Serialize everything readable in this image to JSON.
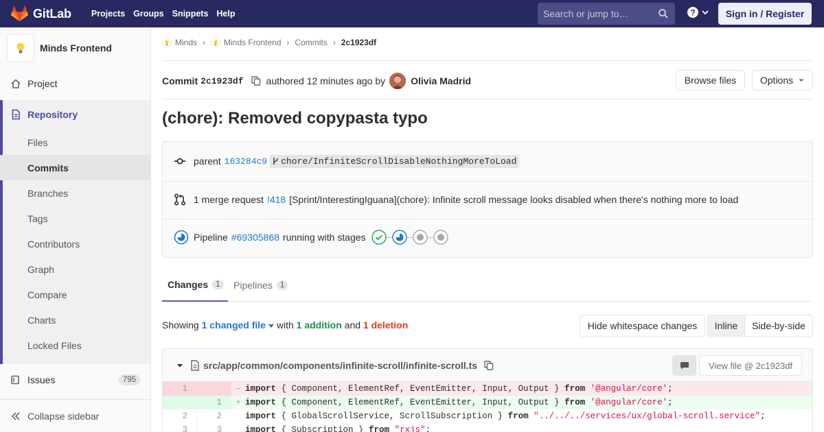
{
  "navbar": {
    "brand": "GitLab",
    "links": [
      "Projects",
      "Groups",
      "Snippets",
      "Help"
    ],
    "search_placeholder": "Search or jump to…",
    "sign_in": "Sign in / Register"
  },
  "sidebar": {
    "project_name": "Minds Frontend",
    "project": "Project",
    "repository": "Repository",
    "sub_items": [
      "Files",
      "Commits",
      "Branches",
      "Tags",
      "Contributors",
      "Graph",
      "Compare",
      "Charts",
      "Locked Files"
    ],
    "active_sub": "Commits",
    "issues": "Issues",
    "issues_count": "795",
    "collapse": "Collapse sidebar"
  },
  "breadcrumb": [
    "Minds",
    "Minds Frontend",
    "Commits",
    "2c1923df"
  ],
  "commit": {
    "label": "Commit",
    "sha": "2c1923df",
    "authored": "authored 12 minutes ago by",
    "author": "Olivia Madrid",
    "browse_files": "Browse files",
    "options": "Options",
    "title": "(chore): Removed copypasta typo"
  },
  "info": {
    "parent_label": "parent",
    "parent_sha": "163284c9",
    "branch": "chore/InfiniteScrollDisableNothingMoreToLoad",
    "mr_prefix": "1 merge request",
    "mr_id": "!418",
    "mr_title": "[Sprint/InterestingIguana](chore): Infinite scroll message looks disabled when there's nothing more to load",
    "pipeline_label": "Pipeline",
    "pipeline_id": "#69305868",
    "pipeline_status": "running with stages"
  },
  "tabs": [
    {
      "label": "Changes",
      "count": "1"
    },
    {
      "label": "Pipelines",
      "count": "1"
    }
  ],
  "summary": {
    "showing": "Showing",
    "changed": "1 changed file",
    "with": "with",
    "additions": "1 addition",
    "and": "and",
    "deletions": "1 deletion",
    "hide_ws": "Hide whitespace changes",
    "inline": "Inline",
    "side_by_side": "Side-by-side"
  },
  "file": {
    "path": "src/app/common/components/infinite-scroll/infinite-scroll.ts",
    "view_file": "View file @ 2c1923df"
  },
  "diff_lines": [
    {
      "type": "del",
      "old": "1",
      "new": "",
      "sign": "-",
      "kw": "import",
      "mid": " { Component, ElementRef, EventEmitter, Input, Output } ",
      "kw2": "from",
      "str": " '@angular/core'",
      "end": ";"
    },
    {
      "type": "add",
      "old": "",
      "new": "1",
      "sign": "+",
      "kw": "import",
      "mid": " { Component, ElementRef, EventEmitter, Input, Output } ",
      "kw2": "from",
      "str": " '@angular/core'",
      "end": ";"
    },
    {
      "type": "ctx",
      "old": "2",
      "new": "2",
      "sign": "",
      "kw": "import",
      "mid": " { GlobalScrollService, ScrollSubscription } ",
      "kw2": "from",
      "str": " \"../../../services/ux/global-scroll.service\"",
      "end": ";"
    },
    {
      "type": "ctx",
      "old": "3",
      "new": "3",
      "sign": "",
      "kw": "import",
      "mid": " { Subscription } ",
      "kw2": "from",
      "str": " \"rxjs\"",
      "end": ";"
    }
  ]
}
